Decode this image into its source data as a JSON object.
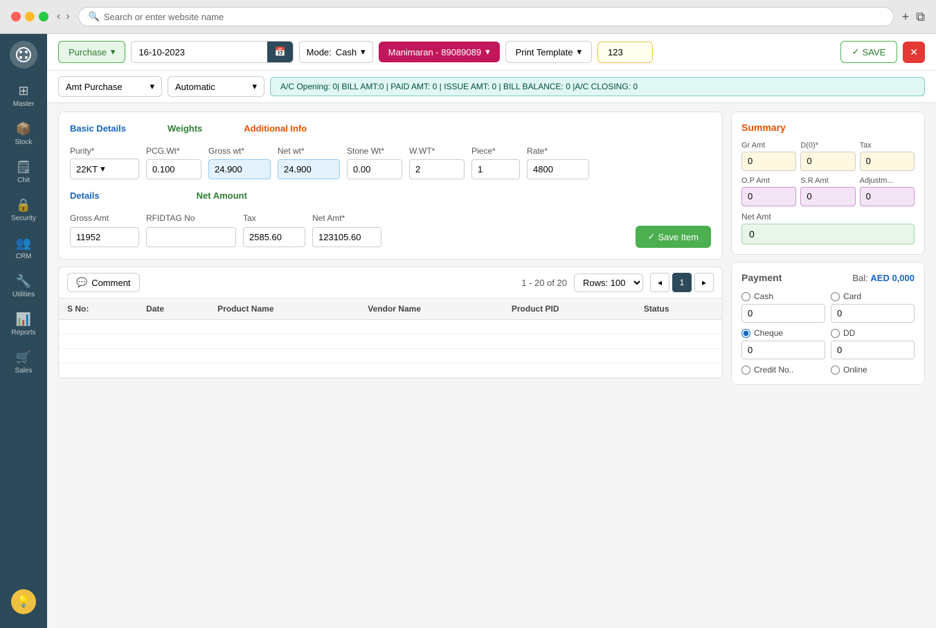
{
  "browser": {
    "address": "Search or enter website name"
  },
  "sidebar": {
    "items": [
      {
        "id": "master",
        "label": "Master",
        "icon": "⊞"
      },
      {
        "id": "stock",
        "label": "Stock",
        "icon": "📦"
      },
      {
        "id": "chit",
        "label": "Chit",
        "icon": "🗒"
      },
      {
        "id": "security",
        "label": "Security",
        "icon": "🔒"
      },
      {
        "id": "crm",
        "label": "CRM",
        "icon": "👥"
      },
      {
        "id": "utilities",
        "label": "Utilities",
        "icon": "🔧"
      },
      {
        "id": "reports",
        "label": "Reports",
        "icon": "📊"
      },
      {
        "id": "sales",
        "label": "Sales",
        "icon": "🛒"
      }
    ]
  },
  "toolbar": {
    "purchase_label": "Purchase",
    "date_value": "16-10-2023",
    "mode_label": "Mode:",
    "mode_value": "Cash",
    "vendor_label": "Manimaran - 89089089",
    "print_label": "Print Template",
    "bill_no": "123",
    "save_label": "SAVE"
  },
  "sub_toolbar": {
    "amt_label": "Amt Purchase",
    "auto_label": "Automatic",
    "account_info": "A/C Opening: 0| BILL AMT:0 | PAID AMT: 0 | ISSUE AMT: 0 | BILL BALANCE: 0 |A/C CLOSING: 0"
  },
  "form": {
    "basic_details_title": "Basic Details",
    "weights_title": "Weights",
    "additional_info_title": "Additional Info",
    "purity_label": "Purity*",
    "purity_value": "22KT",
    "pcg_wt_label": "PCG.Wt*",
    "pcg_wt_value": "0.100",
    "gross_wt_label": "Gross wt*",
    "gross_wt_value": "24.900",
    "net_wt_label": "Net wt*",
    "net_wt_value": "24.900",
    "stone_wt_label": "Stone Wt*",
    "stone_wt_value": "0.00",
    "wwt_label": "W.WT*",
    "wwt_value": "2",
    "piece_label": "Piece*",
    "piece_value": "1",
    "rate_label": "Rate*",
    "rate_value": "4800",
    "details_title": "Details",
    "net_amount_title": "Net Amount",
    "gross_amt_label": "Gross Amt",
    "gross_amt_value": "11952",
    "rfid_label": "RFIDTAG No",
    "rfid_value": "",
    "tax_label": "Tax",
    "tax_value": "2585.60",
    "net_amt_label": "Net Amt*",
    "net_amt_value": "123105.60",
    "save_item_label": "Save Item"
  },
  "summary": {
    "title": "Summary",
    "gr_amt_label": "Gr Amt",
    "gr_amt_value": "0",
    "d0_label": "D(0)*",
    "d0_value": "0",
    "tax_label": "Tax",
    "tax_value": "0",
    "op_amt_label": "O.P Amt",
    "op_amt_value": "0",
    "sr_amt_label": "S.R Amt",
    "sr_amt_value": "0",
    "adjust_label": "Adjustm...",
    "adjust_value": "0",
    "net_amt_label": "Net Amt",
    "net_amt_value": "0"
  },
  "payment": {
    "title": "Payment",
    "bal_label": "Bal:",
    "bal_value": "AED 0,000",
    "cash_label": "Cash",
    "card_label": "Card",
    "cheque_label": "Cheque",
    "dd_label": "DD",
    "credit_no_label": "Credit No..",
    "online_label": "Online",
    "cash_value": "0",
    "card_value": "0",
    "cheque_value": "0",
    "dd_value": "0"
  },
  "table": {
    "comment_label": "Comment",
    "pagination_info": "1 - 20 of 20",
    "rows_label": "Rows: 100",
    "page_current": "1",
    "columns": [
      "S No:",
      "Date",
      "Product Name",
      "Vendor Name",
      "Product PID",
      "Status"
    ],
    "rows": [
      [],
      [],
      [],
      []
    ]
  }
}
